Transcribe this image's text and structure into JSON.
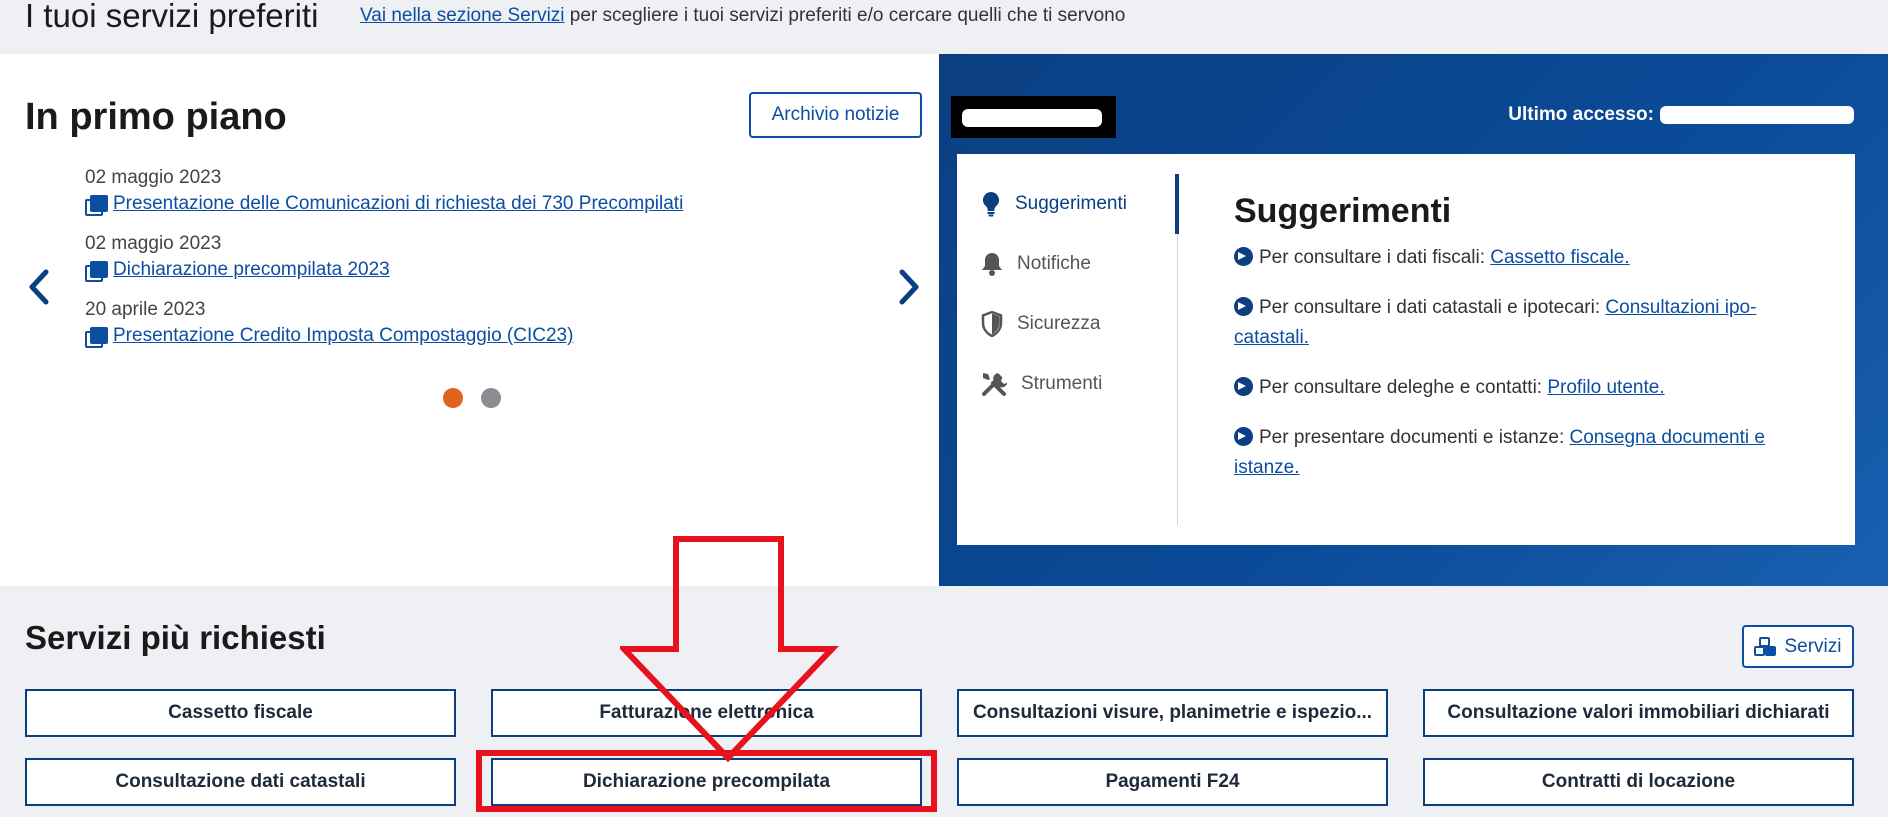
{
  "favorites": {
    "title": "I tuoi servizi preferiti",
    "link": "Vai nella sezione Servizi",
    "description": " per scegliere i tuoi servizi preferiti e/o cercare quelli che ti servono"
  },
  "news": {
    "title": "In primo piano",
    "archive_button": "Archivio notizie",
    "items": [
      {
        "date": "02 maggio 2023",
        "label": "Presentazione delle Comunicazioni di richiesta dei 730 Precompilati"
      },
      {
        "date": "02 maggio 2023",
        "label": "Dichiarazione precompilata 2023"
      },
      {
        "date": "20 aprile 2023",
        "label": "Presentazione Credito Imposta Compostaggio (CIC23)"
      }
    ],
    "dots": {
      "active": "#e0641e",
      "inactive": "#8a8d91"
    }
  },
  "user": {
    "last_access_label": "Ultimo accesso:"
  },
  "menu": {
    "items": [
      {
        "label": "Suggerimenti",
        "icon": "lightbulb-icon"
      },
      {
        "label": "Notifiche",
        "icon": "bell-icon"
      },
      {
        "label": "Sicurezza",
        "icon": "shield-icon"
      },
      {
        "label": "Strumenti",
        "icon": "tools-icon"
      }
    ]
  },
  "tips": {
    "title": "Suggerimenti",
    "items": [
      {
        "text": "Per consultare i dati fiscali: ",
        "link": "Cassetto fiscale."
      },
      {
        "text": "Per consultare i dati catastali e ipotecari: ",
        "link": "Consultazioni ipo-catastali."
      },
      {
        "text": "Per consultare deleghe e contatti: ",
        "link": "Profilo utente."
      },
      {
        "text": "Per presentare documenti e istanze: ",
        "link": "Consegna documenti e istanze."
      }
    ]
  },
  "services": {
    "title": "Servizi più richiesti",
    "button": "Servizi",
    "items": [
      "Cassetto fiscale",
      "Fatturazione elettronica",
      "Consultazioni visure, planimetrie e ispezio...",
      "Consultazione valori immobiliari dichiarati",
      "Consultazione dati catastali",
      "Dichiarazione precompilata",
      "Pagamenti F24",
      "Contratti di locazione"
    ]
  },
  "colors": {
    "brand_blue": "#0b3f82",
    "link_blue": "#0b4ea2",
    "annotation_red": "#e8121f"
  }
}
